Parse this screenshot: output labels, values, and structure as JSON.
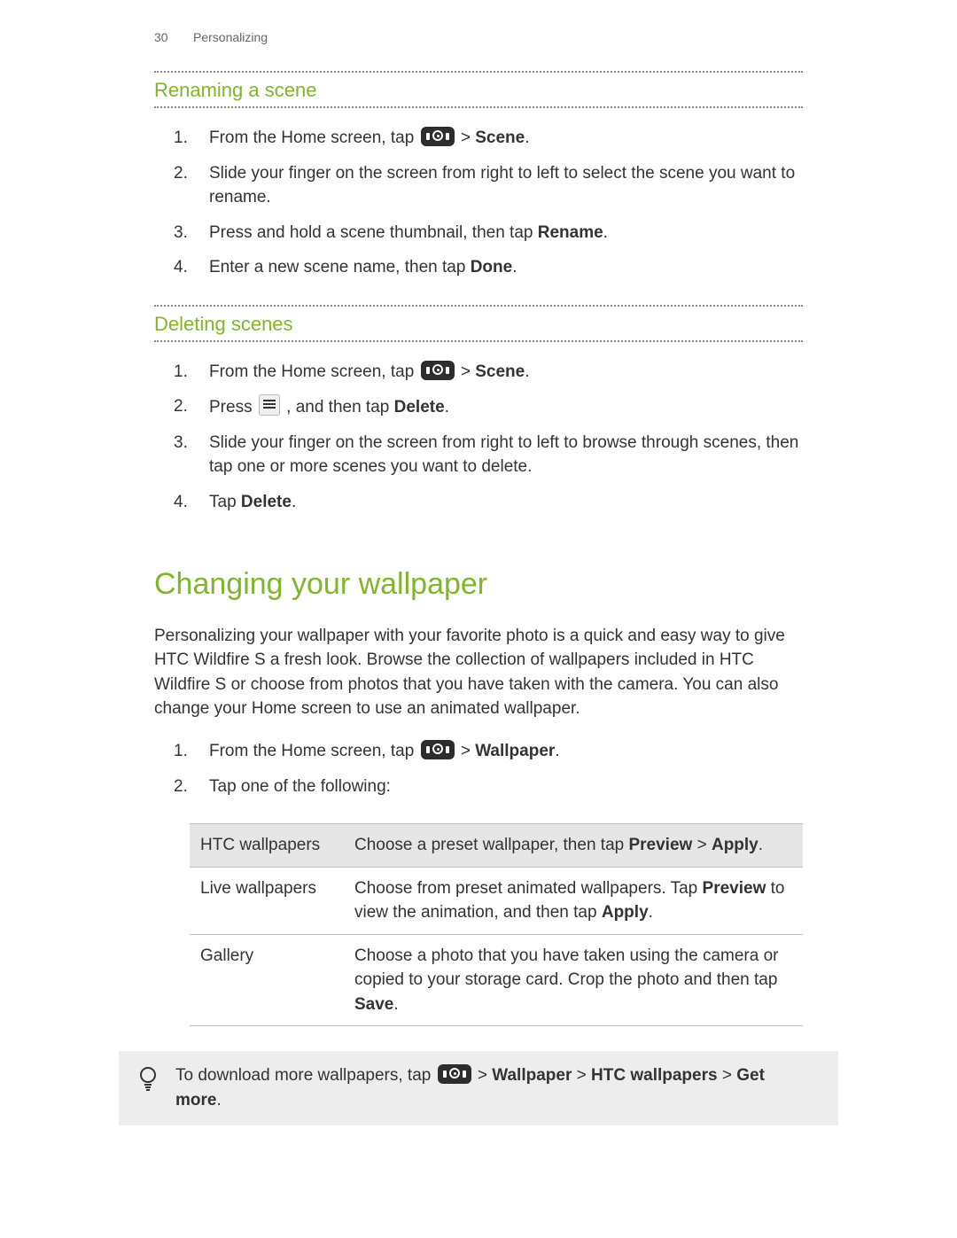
{
  "header": {
    "page_number": "30",
    "chapter": "Personalizing"
  },
  "section1": {
    "title": "Renaming a scene",
    "steps": {
      "s1_pre": "From the Home screen, tap ",
      "s1_mid": " > ",
      "s1_scene": "Scene",
      "s1_post": ".",
      "s2": "Slide your finger on the screen from right to left to select the scene you want to rename.",
      "s3_pre": "Press and hold a scene thumbnail, then tap ",
      "s3_bold": "Rename",
      "s3_post": ".",
      "s4_pre": "Enter a new scene name, then tap ",
      "s4_bold": "Done",
      "s4_post": "."
    }
  },
  "section2": {
    "title": "Deleting scenes",
    "steps": {
      "s1_pre": "From the Home screen, tap ",
      "s1_mid": " > ",
      "s1_scene": "Scene",
      "s1_post": ".",
      "s2_pre": "Press ",
      "s2_mid": ", and then tap ",
      "s2_bold": "Delete",
      "s2_post": ".",
      "s3": "Slide your finger on the screen from right to left to browse through scenes, then tap one or more scenes you want to delete.",
      "s4_pre": "Tap ",
      "s4_bold": "Delete",
      "s4_post": "."
    }
  },
  "section3": {
    "title": "Changing your wallpaper",
    "intro": "Personalizing your wallpaper with your favorite photo is a quick and easy way to give HTC Wildfire S a fresh look. Browse the collection of wallpapers included in HTC Wildfire S or choose from photos that you have taken with the camera. You can also change your Home screen to use an animated wallpaper.",
    "steps": {
      "s1_pre": "From the Home screen, tap ",
      "s1_mid": " > ",
      "s1_bold": "Wallpaper",
      "s1_post": ".",
      "s2": "Tap one of the following:"
    },
    "table": {
      "r1_label": "HTC wallpapers",
      "r1_pre": "Choose a preset wallpaper, then tap ",
      "r1_b1": "Preview",
      "r1_mid": " > ",
      "r1_b2": "Apply",
      "r1_post": ".",
      "r2_label": "Live wallpapers",
      "r2_pre": "Choose from preset animated wallpapers. Tap ",
      "r2_b1": "Preview",
      "r2_mid": " to view the animation, and then tap ",
      "r2_b2": "Apply",
      "r2_post": ".",
      "r3_label": "Gallery",
      "r3_pre": "Choose a photo that you have taken using the camera or copied to your storage card. Crop the photo and then tap ",
      "r3_b1": "Save",
      "r3_post": "."
    },
    "tip": {
      "pre": "To download more wallpapers, tap ",
      "mid": " > ",
      "b1": "Wallpaper",
      "sep": " > ",
      "b2": "HTC wallpapers",
      "sep2": " > ",
      "b3": "Get more",
      "post": "."
    }
  },
  "nums": {
    "n1": "1.",
    "n2": "2.",
    "n3": "3.",
    "n4": "4."
  }
}
